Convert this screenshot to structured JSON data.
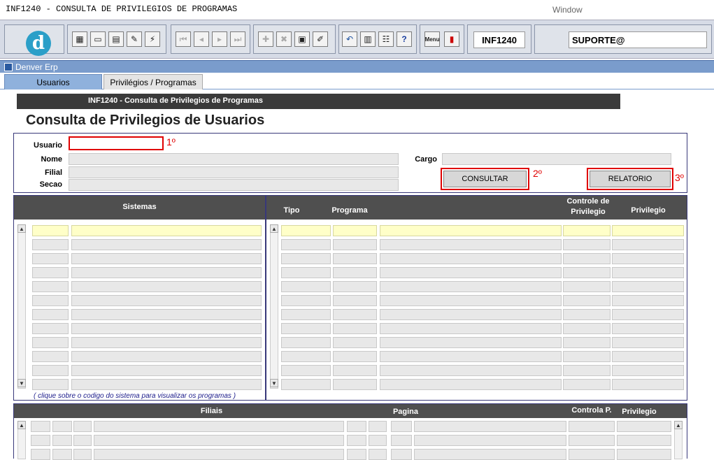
{
  "window": {
    "title": "INF1240 - CONSULTA DE PRIVILEGIOS DE PROGRAMAS",
    "menu": "Window"
  },
  "toolbar": {
    "module_field": "INF1240",
    "user_field": "SUPORTE@",
    "icons": [
      "logo-icon",
      "save-icon",
      "screen-icon",
      "print-icon",
      "help-query-icon",
      "run-icon",
      "first-record-icon",
      "prev-record-icon",
      "next-record-icon",
      "last-record-icon",
      "add-record-icon",
      "delete-record-icon",
      "query-icon",
      "edit-icon",
      "undo-icon",
      "clipboard-icon",
      "tools-icon",
      "help-icon",
      "menu-icon",
      "exit-icon"
    ],
    "help_glyph": "?",
    "menu_glyph": "Menu"
  },
  "frame": {
    "label": "Denver Erp"
  },
  "tabs": [
    {
      "label": "Usuarios"
    },
    {
      "label": "Privilégios / Programas"
    }
  ],
  "form": {
    "banner": "INF1240 - Consulta de Privilegios de Programas",
    "title": "Consulta de Privilegios de Usuarios",
    "labels": {
      "usuario": "Usuario",
      "nome": "Nome",
      "filial": "Filial",
      "secao": "Secao",
      "cargo": "Cargo"
    },
    "buttons": {
      "consultar": "CONSULTAR",
      "relatorio": "RELATORIO"
    },
    "steps": [
      "1º",
      "2º",
      "3º"
    ]
  },
  "grid_sistemas": {
    "header": "Sistemas",
    "hint": "( clique sobre o codigo do sistema para visualizar os programas )"
  },
  "grid_programas": {
    "headers": {
      "tipo": "Tipo",
      "programa": "Programa",
      "controle": "Controle de Privilegio",
      "privilegio": "Privilegio"
    }
  },
  "grid_filiais": {
    "headers": {
      "filiais": "Filiais",
      "pagina": "Pagina",
      "controla": "Controla P.",
      "privilegio": "Privilegio"
    }
  },
  "colors": {
    "highlight": "#ffffc8",
    "step_red": "#e00000",
    "header_dark": "#4f4f4f"
  }
}
